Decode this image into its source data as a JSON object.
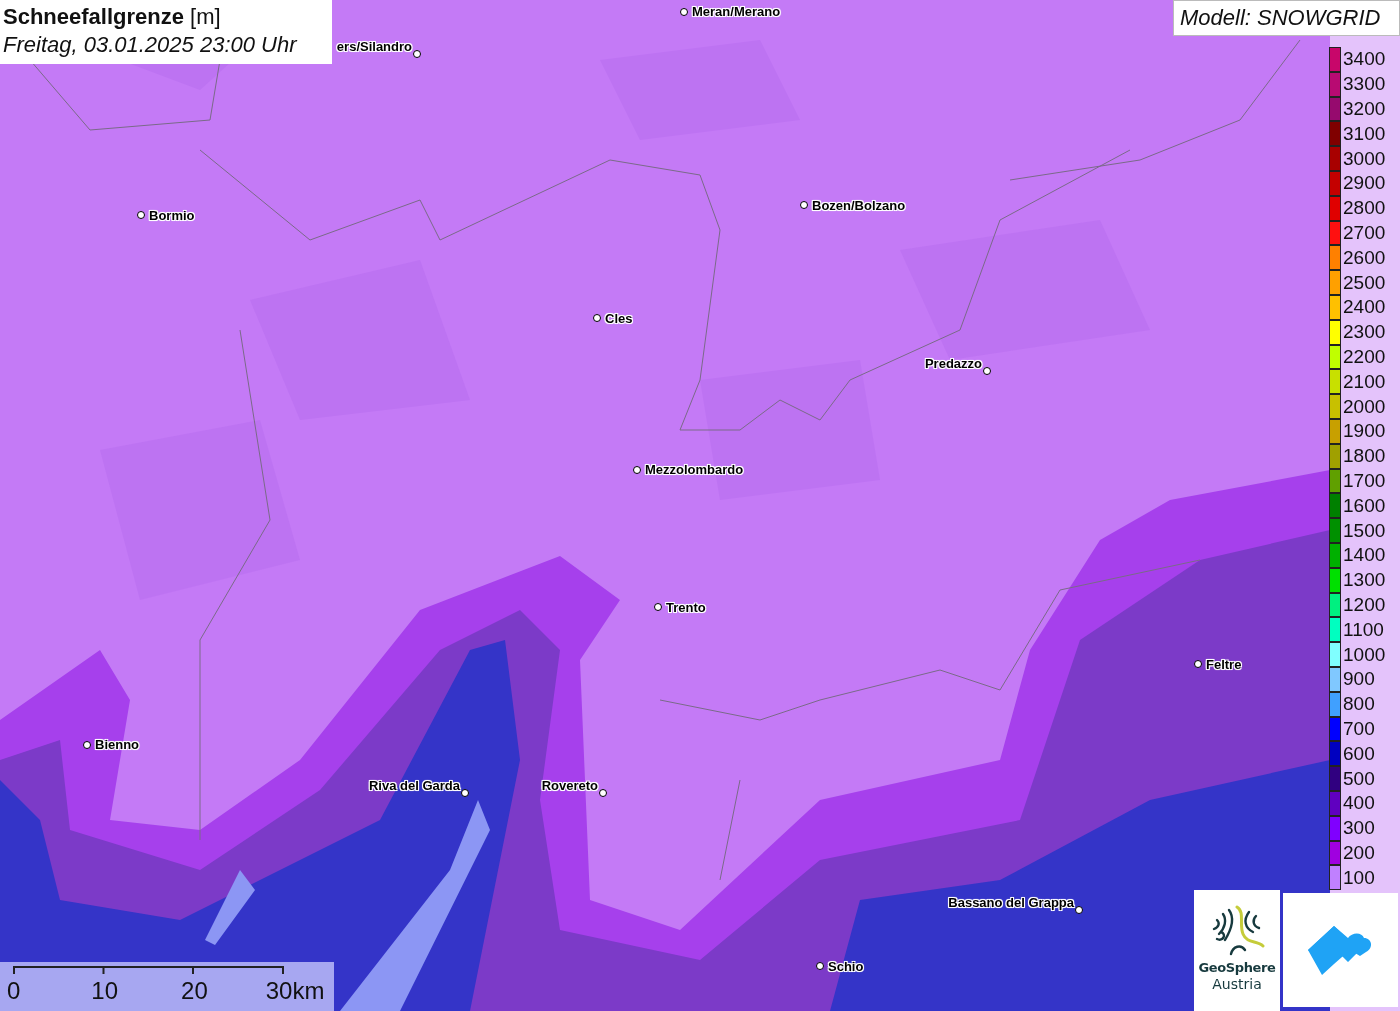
{
  "title": {
    "heading": "**Schneefallgrenze** [m]",
    "time": "Freitag, 03.01.2025 23:00 Uhr"
  },
  "model": "Modell: SNOWGRID",
  "cities": [
    {
      "name": "Meran/Merano"
    },
    {
      "name": "ers/Silandro"
    },
    {
      "name": "Bormio"
    },
    {
      "name": "Bozen/Bolzano"
    },
    {
      "name": "Cles"
    },
    {
      "name": "Predazzo"
    },
    {
      "name": "Mezzolombardo"
    },
    {
      "name": "Trento"
    },
    {
      "name": "Feltre"
    },
    {
      "name": "Bienno"
    },
    {
      "name": "Riva del Garda"
    },
    {
      "name": "Rovereto"
    },
    {
      "name": "Bassano del Grappa"
    },
    {
      "name": "Schio"
    }
  ],
  "legend": [
    {
      "label": "3400",
      "color": "#c8066a"
    },
    {
      "label": "3300",
      "color": "#b80a72"
    },
    {
      "label": "3200",
      "color": "#960a6e"
    },
    {
      "label": "3100",
      "color": "#800000"
    },
    {
      "label": "3000",
      "color": "#a80000"
    },
    {
      "label": "2900",
      "color": "#c40000"
    },
    {
      "label": "2800",
      "color": "#e00000"
    },
    {
      "label": "2700",
      "color": "#ff1010"
    },
    {
      "label": "2600",
      "color": "#ff8000"
    },
    {
      "label": "2500",
      "color": "#ffa000"
    },
    {
      "label": "2400",
      "color": "#ffc000"
    },
    {
      "label": "2300",
      "color": "#ffff00"
    },
    {
      "label": "2200",
      "color": "#c0ff00"
    },
    {
      "label": "2100",
      "color": "#c8e000"
    },
    {
      "label": "2000",
      "color": "#c8c000"
    },
    {
      "label": "1900",
      "color": "#c8a000"
    },
    {
      "label": "1800",
      "color": "#a0a000"
    },
    {
      "label": "1700",
      "color": "#60a000"
    },
    {
      "label": "1600",
      "color": "#008000"
    },
    {
      "label": "1500",
      "color": "#009000"
    },
    {
      "label": "1400",
      "color": "#00b000"
    },
    {
      "label": "1300",
      "color": "#00e000"
    },
    {
      "label": "1200",
      "color": "#00f080"
    },
    {
      "label": "1100",
      "color": "#00ffc0"
    },
    {
      "label": "1000",
      "color": "#80ffff"
    },
    {
      "label": "900",
      "color": "#80c8ff"
    },
    {
      "label": "800",
      "color": "#40a0ff"
    },
    {
      "label": "700",
      "color": "#0000ff"
    },
    {
      "label": "600",
      "color": "#0000c0"
    },
    {
      "label": "500",
      "color": "#300080"
    },
    {
      "label": "400",
      "color": "#6000c0"
    },
    {
      "label": "300",
      "color": "#8000ff"
    },
    {
      "label": "200",
      "color": "#a000e0"
    },
    {
      "label": "100",
      "color": "#c080ff"
    }
  ],
  "scale": [
    "0",
    "10",
    "20",
    "30km"
  ],
  "logo": {
    "name": "GeoSphere",
    "country": "Austria"
  }
}
